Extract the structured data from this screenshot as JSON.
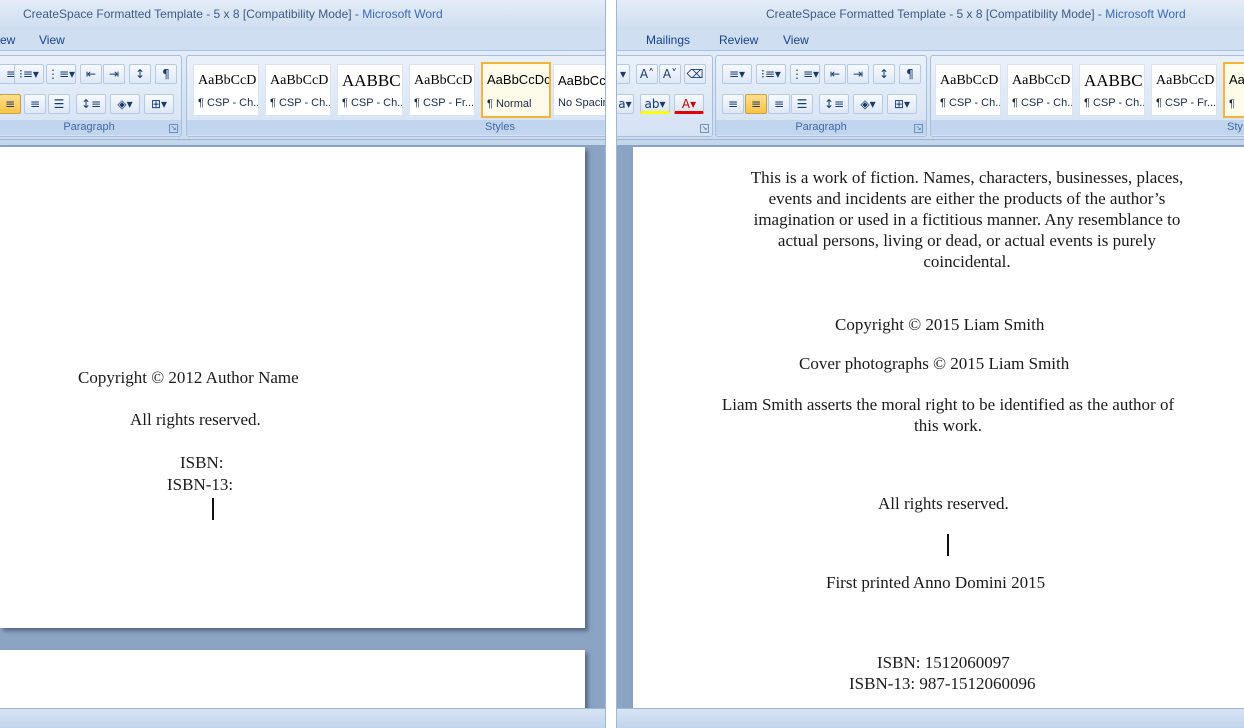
{
  "left": {
    "title_doc": "CreateSpace Formatted Template - 5 x 8 [Compatibility Mode] - ",
    "title_app": "Microsoft Word",
    "tabs": [
      "ew",
      "View"
    ],
    "groups": {
      "paragraph": "Paragraph",
      "styles": "Styles"
    },
    "styles": [
      {
        "sample": "AaBbCcD",
        "name": "¶ CSP - Ch..."
      },
      {
        "sample": "AaBbCcD",
        "name": "¶ CSP - Ch..."
      },
      {
        "sample": "AABBC",
        "name": "¶ CSP - Ch..."
      },
      {
        "sample": "AaBbCcD",
        "name": "¶ CSP - Fr..."
      },
      {
        "sample": "AaBbCcDc",
        "name": "¶ Normal"
      },
      {
        "sample": "AaBbCc",
        "name": "No Spacin"
      }
    ],
    "page": {
      "copyright": "Copyright © 2012 Author Name",
      "rights": "All rights reserved.",
      "isbn": "ISBN:",
      "isbn13": "ISBN-13:"
    }
  },
  "right": {
    "title_doc": "CreateSpace Formatted Template - 5 x 8 [Compatibility Mode] - ",
    "title_app": "Microsoft Word",
    "tabs": [
      "Mailings",
      "Review",
      "View"
    ],
    "groups": {
      "paragraph": "Paragraph",
      "styles": "Sty"
    },
    "styles": [
      {
        "sample": "AaBbCcD",
        "name": "¶ CSP - Ch..."
      },
      {
        "sample": "AaBbCcD",
        "name": "¶ CSP - Ch..."
      },
      {
        "sample": "AABBC",
        "name": "¶ CSP - Ch..."
      },
      {
        "sample": "AaBbCcD",
        "name": "¶ CSP - Fr..."
      },
      {
        "sample": "Aa",
        "name": "¶"
      }
    ],
    "page": {
      "disclaimer": "This is a work of fiction. Names, characters, businesses, places, events and incidents are either the products of the author’s imagination or used in a fictitious manner. Any resemblance to actual persons, living or dead, or actual events is purely coincidental.",
      "copyright": "Copyright © 2015 Liam Smith",
      "cover": "Cover photographs © 2015 Liam Smith",
      "moral_right": "Liam Smith asserts the moral right to be identified as the author of this work.",
      "rights": "All rights reserved.",
      "printed": "First printed Anno Domini 2015",
      "isbn": "ISBN: 1512060097",
      "isbn13": "ISBN-13: 987-1512060096"
    }
  },
  "icons": {
    "bullets": "bullets-icon",
    "numbering": "numbering-icon",
    "multilevel": "multilevel-list-icon",
    "decrease_indent": "decrease-indent-icon",
    "increase_indent": "increase-indent-icon",
    "sort": "sort-icon",
    "pilcrow": "show-formatting-icon",
    "align_center": "align-center-icon",
    "align_right": "align-right-icon",
    "justify": "justify-icon",
    "line_spacing": "line-spacing-icon",
    "shading": "shading-icon",
    "borders": "borders-icon",
    "grow_font": "grow-font-icon",
    "shrink_font": "shrink-font-icon",
    "clear_format": "clear-formatting-icon",
    "highlight": "highlight-icon",
    "font_color": "font-color-icon",
    "align_left": "align-left-icon"
  },
  "colors": {
    "accent": "#15428b",
    "selected_style": "#f2b43c",
    "ribbon": "#dce7f5",
    "font_color_bar": "#e00000",
    "highlight_bar": "#ffff00"
  }
}
